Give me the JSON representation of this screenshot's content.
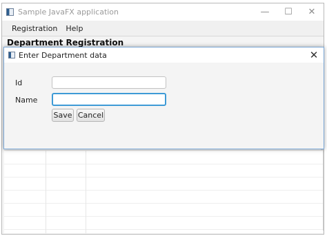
{
  "window": {
    "title": "Sample JavaFX application",
    "minimize_icon": "minimize-icon",
    "maximize_icon": "maximize-icon",
    "close_icon": "close-icon"
  },
  "menubar": {
    "items": [
      {
        "label": "Registration"
      },
      {
        "label": "Help"
      }
    ]
  },
  "section": {
    "heading": "Department Registration"
  },
  "dialog": {
    "title": "Enter Department data",
    "fields": [
      {
        "label": "Id",
        "value": "",
        "placeholder": ""
      },
      {
        "label": "Name",
        "value": "",
        "placeholder": "",
        "focused": true
      }
    ],
    "buttons": {
      "save": "Save",
      "cancel": "Cancel"
    }
  },
  "colors": {
    "focus_accent": "#3d9ad6",
    "dialog_border": "#7aa7d6"
  }
}
